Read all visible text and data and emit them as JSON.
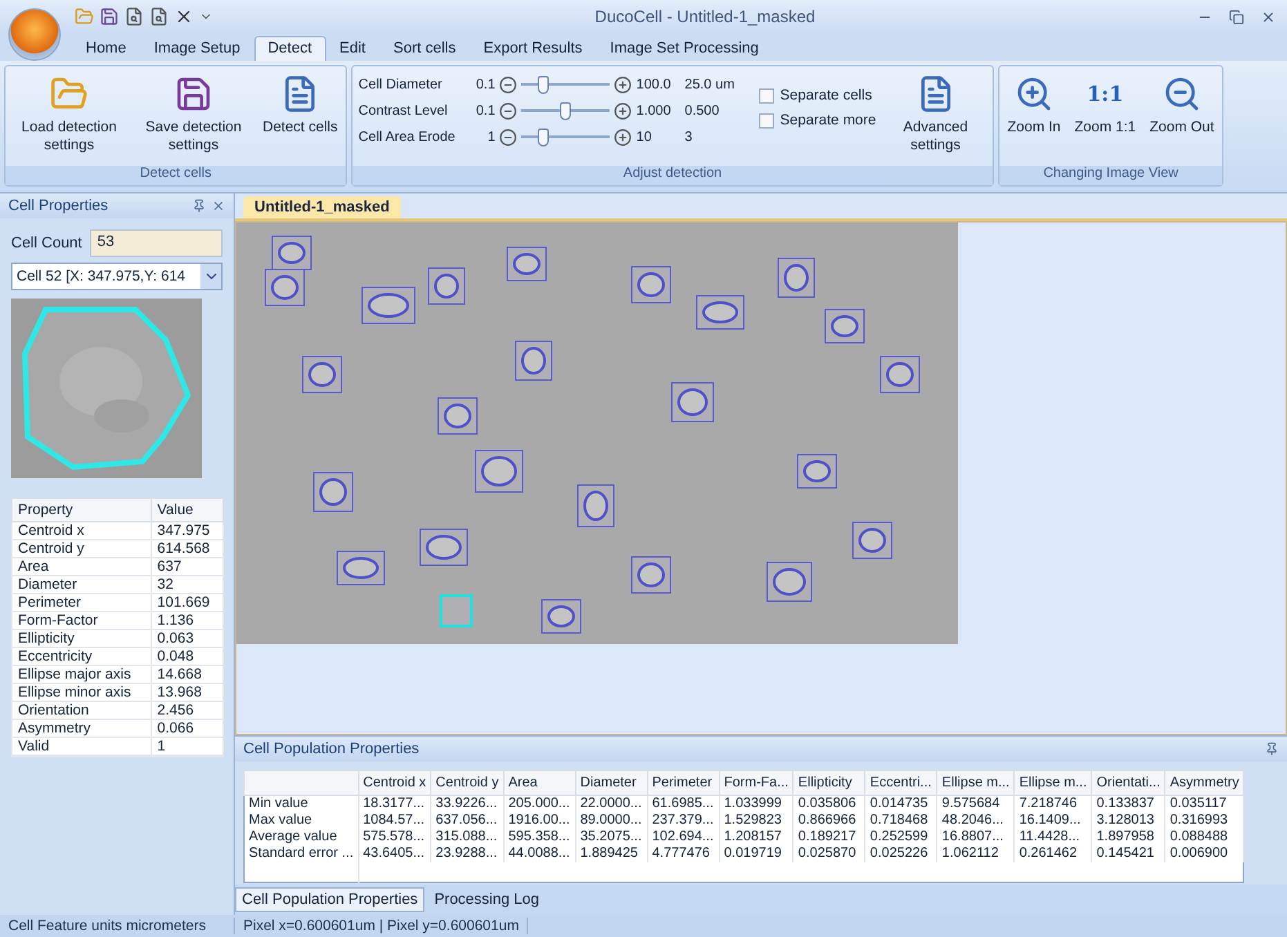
{
  "window": {
    "title": "DucoCell - Untitled-1_masked"
  },
  "ribbon_tabs": [
    {
      "label": "Home",
      "selected": false
    },
    {
      "label": "Image Setup",
      "selected": false
    },
    {
      "label": "Detect",
      "selected": true
    },
    {
      "label": "Edit",
      "selected": false
    },
    {
      "label": "Sort cells",
      "selected": false
    },
    {
      "label": "Export Results",
      "selected": false
    },
    {
      "label": "Image Set Processing",
      "selected": false
    }
  ],
  "ribbon_groups": [
    {
      "kind": "buttons",
      "title": "Detect cells",
      "buttons": [
        {
          "label": "Load detection settings"
        },
        {
          "label": "Save detection settings"
        },
        {
          "label": "Detect cells"
        }
      ]
    },
    {
      "kind": "adjust",
      "title": "Adjust detection",
      "sliders": [
        {
          "label": "Cell Diameter",
          "min": "0.1",
          "max": "100.0",
          "value": "25.0 um",
          "level": 0.25
        },
        {
          "label": "Contrast Level",
          "min": "0.1",
          "max": "1.000",
          "value": "0.500",
          "level": 0.5
        },
        {
          "label": "Cell Area Erode",
          "min": "1",
          "max": "10",
          "value": "3",
          "level": 0.25
        }
      ],
      "checkboxes": [
        {
          "label": "Separate cells",
          "checked": false
        },
        {
          "label": "Separate more",
          "checked": false
        }
      ],
      "button": {
        "label": "Advanced settings"
      }
    },
    {
      "kind": "buttons",
      "title": "Changing Image View",
      "buttons": [
        {
          "label": "Zoom In"
        },
        {
          "label": "Zoom 1:1",
          "icon_text": "1:1"
        },
        {
          "label": "Zoom Out"
        }
      ]
    }
  ],
  "cell_properties": {
    "title": "Cell Properties",
    "cell_count_label": "Cell Count",
    "cell_count": "53",
    "cell_select": "Cell 52  [X: 347.975,Y: 614",
    "columns": [
      "Property",
      "Value"
    ],
    "rows": [
      [
        "Centroid x",
        "347.975"
      ],
      [
        "Centroid y",
        "614.568"
      ],
      [
        "Area",
        "637"
      ],
      [
        "Diameter",
        "32"
      ],
      [
        "Perimeter",
        "101.669"
      ],
      [
        "Form-Factor",
        "1.136"
      ],
      [
        "Ellipticity",
        "0.063"
      ],
      [
        "Eccentricity",
        "0.048"
      ],
      [
        "Ellipse major axis",
        "14.668"
      ],
      [
        "Ellipse minor axis",
        "13.968"
      ],
      [
        "Orientation",
        "2.456"
      ],
      [
        "Asymmetry",
        "0.066"
      ],
      [
        "Valid",
        "1"
      ]
    ]
  },
  "document_tabs": [
    {
      "label": "Untitled-1_masked",
      "selected": true
    }
  ],
  "population": {
    "title": "Cell Population Properties",
    "columns": [
      "",
      "Centroid x",
      "Centroid y",
      "Area",
      "Diameter",
      "Perimeter",
      "Form-Fa...",
      "Ellipticity",
      "Eccentri...",
      "Ellipse m...",
      "Ellipse m...",
      "Orientati...",
      "Asymmetry"
    ],
    "rows": [
      [
        "Min value",
        "18.3177...",
        "33.9226...",
        "205.000...",
        "22.0000...",
        "61.6985...",
        "1.033999",
        "0.035806",
        "0.014735",
        "9.575684",
        "7.218746",
        "0.133837",
        "0.035117"
      ],
      [
        "Max value",
        "1084.57...",
        "637.056...",
        "1916.00...",
        "89.0000...",
        "237.379...",
        "1.529823",
        "0.866966",
        "0.718468",
        "48.2046...",
        "16.1409...",
        "3.128013",
        "0.316993"
      ],
      [
        "Average value",
        "575.578...",
        "315.088...",
        "595.358...",
        "35.2075...",
        "102.694...",
        "1.208157",
        "0.189217",
        "0.252599",
        "16.8807...",
        "11.4428...",
        "1.897958",
        "0.088488"
      ],
      [
        "Standard error ...",
        "43.6405...",
        "23.9288...",
        "44.0088...",
        "1.889425",
        "4.777476",
        "0.019719",
        "0.025870",
        "0.025226",
        "1.062112",
        "0.261462",
        "0.145421",
        "0.006900"
      ]
    ],
    "tabs": [
      {
        "label": "Cell Population Properties",
        "selected": true
      },
      {
        "label": "Processing Log",
        "selected": false
      }
    ]
  },
  "status_bar": [
    "Cell Feature units micrometers",
    "Pixel x=0.600601um  |  Pixel y=0.600601um"
  ]
}
